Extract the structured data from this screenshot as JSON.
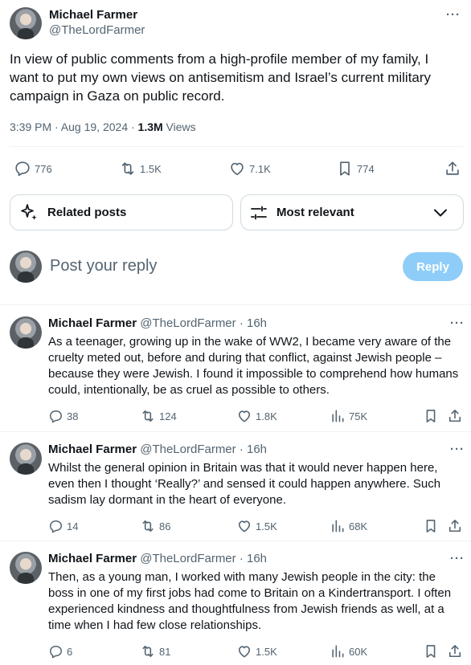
{
  "main_tweet": {
    "author_name": "Michael Farmer",
    "author_handle": "@TheLordFarmer",
    "text": "In view of public comments from a high-profile member of my family, I want to put my own views on antisemitism and Israel’s current military campaign in Gaza on public record.",
    "time_date": "3:39 PM · Aug 19, 2024 · ",
    "views_count": "1.3M",
    "views_label": " Views",
    "more_label": "···",
    "stats": {
      "replies": "776",
      "reposts": "1.5K",
      "likes": "7.1K",
      "bookmarks": "774"
    },
    "icons": [
      "reply-icon",
      "repost-icon",
      "like-icon",
      "bookmark-icon",
      "share-icon"
    ]
  },
  "filters": {
    "related_label": "Related posts",
    "relevance_label": "Most relevant"
  },
  "composer": {
    "placeholder": "Post your reply",
    "reply_button_label": "Reply"
  },
  "replies": [
    {
      "name": "Michael Farmer",
      "handle": "@TheLordFarmer",
      "dot": " · ",
      "time": "16h",
      "text": "As a teenager, growing up in the wake of WW2, I became very aware of the cruelty meted out, before and during that conflict, against Jewish people – because they were Jewish. I found it impossible to comprehend how humans could, intentionally, be as cruel as possible to others.",
      "replies": "38",
      "reposts": "124",
      "likes": "1.8K",
      "views": "75K"
    },
    {
      "name": "Michael Farmer",
      "handle": "@TheLordFarmer",
      "dot": " · ",
      "time": "16h",
      "text": "Whilst the general opinion in Britain was that it would never happen here, even then I thought ‘Really?’ and sensed it could happen anywhere. Such sadism lay dormant in the heart of everyone.",
      "replies": "14",
      "reposts": "86",
      "likes": "1.5K",
      "views": "68K"
    },
    {
      "name": "Michael Farmer",
      "handle": "@TheLordFarmer",
      "dot": " · ",
      "time": "16h",
      "text": "Then, as a young man, I worked with many Jewish people in the city: the boss in one of my first jobs had come to Britain on a Kindertransport. I often experienced kindness and thoughtfulness from Jewish friends as well, at a time when I had few close relationships.",
      "replies": "6",
      "reposts": "81",
      "likes": "1.5K",
      "views": "60K"
    }
  ],
  "colors": {
    "text": "#0f1419",
    "muted": "#536471",
    "border": "#cfd9de",
    "reply_button_disabled": "#8ecdf8"
  }
}
